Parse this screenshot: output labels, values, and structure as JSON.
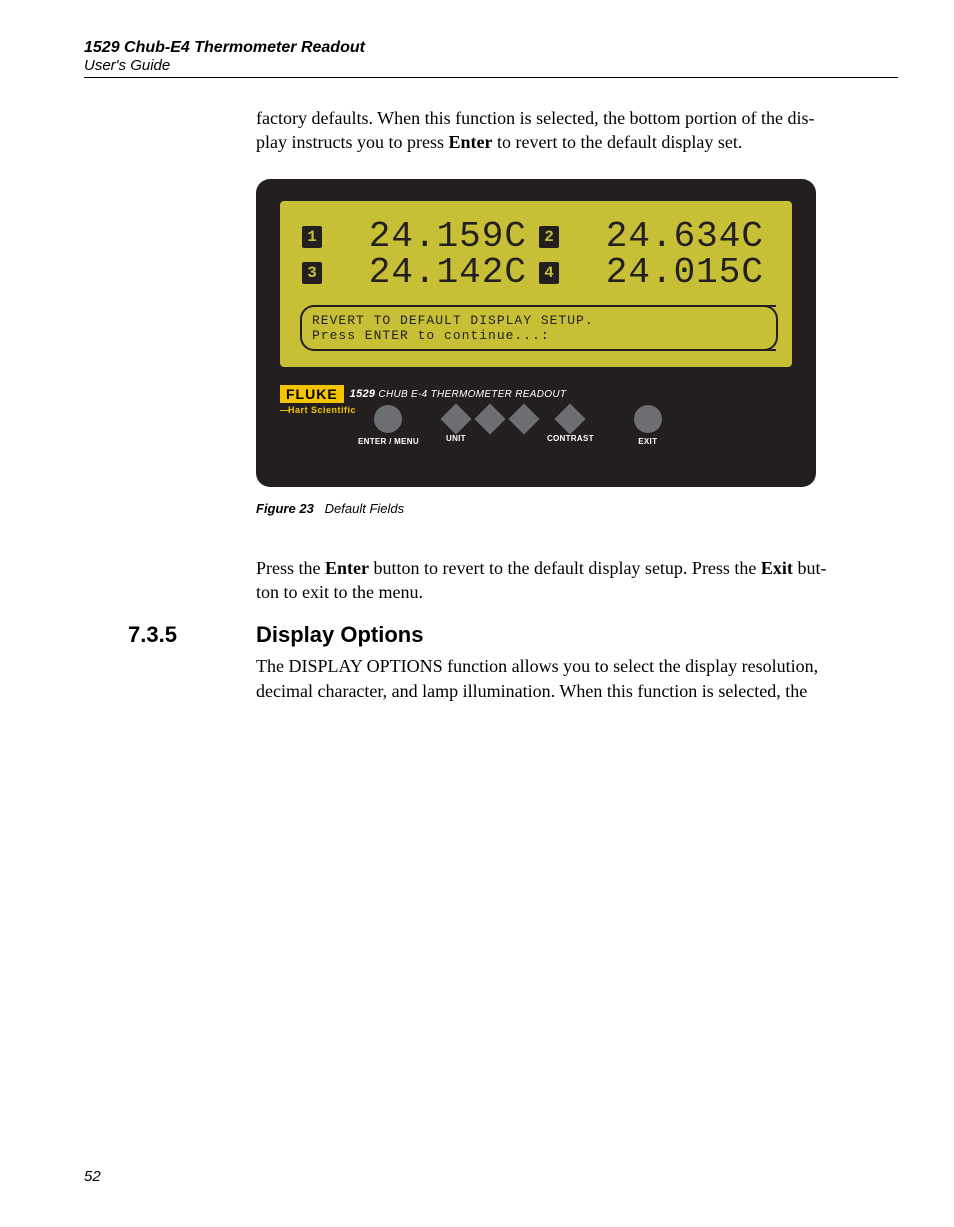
{
  "header": {
    "title": "1529 Chub-E4 Thermometer Readout",
    "subtitle": "User's Guide"
  },
  "para1_a": "factory defaults. When this function is selected, the bottom portion of the dis-",
  "para1_b": "play instructs you to press ",
  "para1_bold": "Enter",
  "para1_c": " to revert to the default display set.",
  "device": {
    "readings": [
      {
        "ch": "1",
        "val": "24.159C"
      },
      {
        "ch": "2",
        "val": "24.634C"
      },
      {
        "ch": "3",
        "val": "24.142C"
      },
      {
        "ch": "4",
        "val": "24.015C"
      }
    ],
    "msg_line1": "REVERT TO DEFAULT DISPLAY SETUP.",
    "msg_line2": "Press ENTER to continue...:",
    "brand": "FLUKE",
    "model_num": "1529",
    "model_rest": " CHUB E-4 THERMOMETER READOUT",
    "hart": "Hart Scientific",
    "buttons": {
      "enter": "ENTER / MENU",
      "unit": "UNIT",
      "contrast": "CONTRAST",
      "exit": "EXIT"
    }
  },
  "figure": {
    "label": "Figure 23",
    "caption": "Default Fields"
  },
  "para2_a": "Press the ",
  "para2_b1": "Enter",
  "para2_c": " button to revert to the default display setup. Press the ",
  "para2_b2": "Exit",
  "para2_d": " but-",
  "para2_e": "ton to exit to the menu.",
  "section": {
    "num": "7.3.5",
    "title": "Display Options"
  },
  "para3_a": "The DISPLAY OPTIONS function allows you to select the display resolution,",
  "para3_b": "decimal character, and lamp illumination. When this function is selected, the",
  "page_number": "52"
}
